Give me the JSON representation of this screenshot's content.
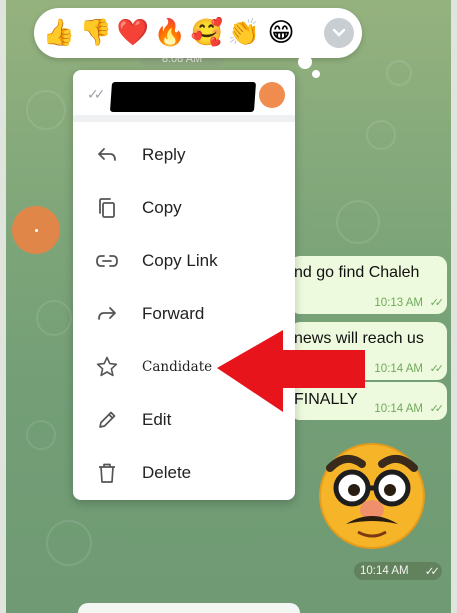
{
  "reactions": [
    {
      "glyph": "👍",
      "name": "thumbs-up"
    },
    {
      "glyph": "👎",
      "name": "thumbs-down"
    },
    {
      "glyph": "❤️",
      "name": "red-heart"
    },
    {
      "glyph": "🔥",
      "name": "fire"
    },
    {
      "glyph": "🥰",
      "name": "smiling-face-with-hearts"
    },
    {
      "glyph": "👏",
      "name": "clapping-hands"
    },
    {
      "glyph": "😁",
      "name": "beaming-face"
    }
  ],
  "top_time": "8:08 AM",
  "menu": {
    "items": [
      {
        "label": "Reply",
        "icon": "reply-icon"
      },
      {
        "label": "Copy",
        "icon": "copy-icon"
      },
      {
        "label": "Copy Link",
        "icon": "link-icon"
      },
      {
        "label": "Forward",
        "icon": "forward-icon"
      },
      {
        "label": "Candidate",
        "icon": "star-icon"
      },
      {
        "label": "Edit",
        "icon": "pencil-icon"
      },
      {
        "label": "Delete",
        "icon": "trash-icon"
      }
    ]
  },
  "messages": [
    {
      "text": "nd go find Chaleh",
      "time": "10:13 AM"
    },
    {
      "text": "news will reach us",
      "time": "10:14 AM"
    },
    {
      "text": "FINALLY",
      "time": "10:14 AM"
    }
  ],
  "sticker_time": "10:14 AM",
  "colors": {
    "accent_orange": "#f08c4e",
    "arrow_red": "#e8141b",
    "bubble_green": "#eefadd",
    "time_green": "#6eaa5a"
  }
}
